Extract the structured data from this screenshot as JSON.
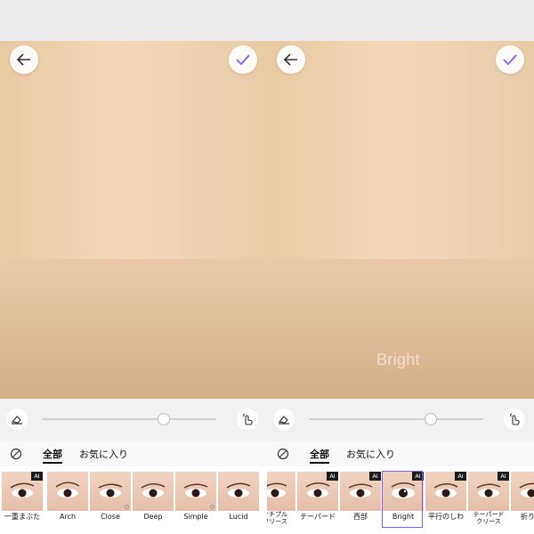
{
  "colors": {
    "accent": "#7b5cff",
    "ai_badge": "#1b1b1b"
  },
  "panels": [
    {
      "id": "left",
      "slider_value": 0.7,
      "watermark": "",
      "tabs": {
        "all": "全部",
        "favorites": "お気に入り"
      },
      "styles": [
        {
          "label": "一重まぶた",
          "ai": true,
          "selected": false
        },
        {
          "label": "Arch",
          "ai": false,
          "selected": false
        },
        {
          "label": "Close",
          "ai": false,
          "selected": false
        },
        {
          "label": "Deep",
          "ai": false,
          "selected": false
        },
        {
          "label": "Simple",
          "ai": false,
          "selected": false
        },
        {
          "label": "Lucid",
          "ai": false,
          "selected": false
        }
      ]
    },
    {
      "id": "right",
      "slider_value": 0.7,
      "watermark": "Bright",
      "tabs": {
        "all": "全部",
        "favorites": "お気に入り"
      },
      "styles": [
        {
          "label": "ナチプル\nクリース",
          "ai": false,
          "selected": false
        },
        {
          "label": "テーパード",
          "ai": true,
          "selected": false
        },
        {
          "label": "西部",
          "ai": true,
          "selected": false
        },
        {
          "label": "Bright",
          "ai": true,
          "selected": true
        },
        {
          "label": "平行のしわ",
          "ai": true,
          "selected": false
        },
        {
          "label": "テーパード\nクリース",
          "ai": true,
          "selected": false
        },
        {
          "label": "折り畳",
          "ai": false,
          "selected": false
        }
      ]
    }
  ]
}
